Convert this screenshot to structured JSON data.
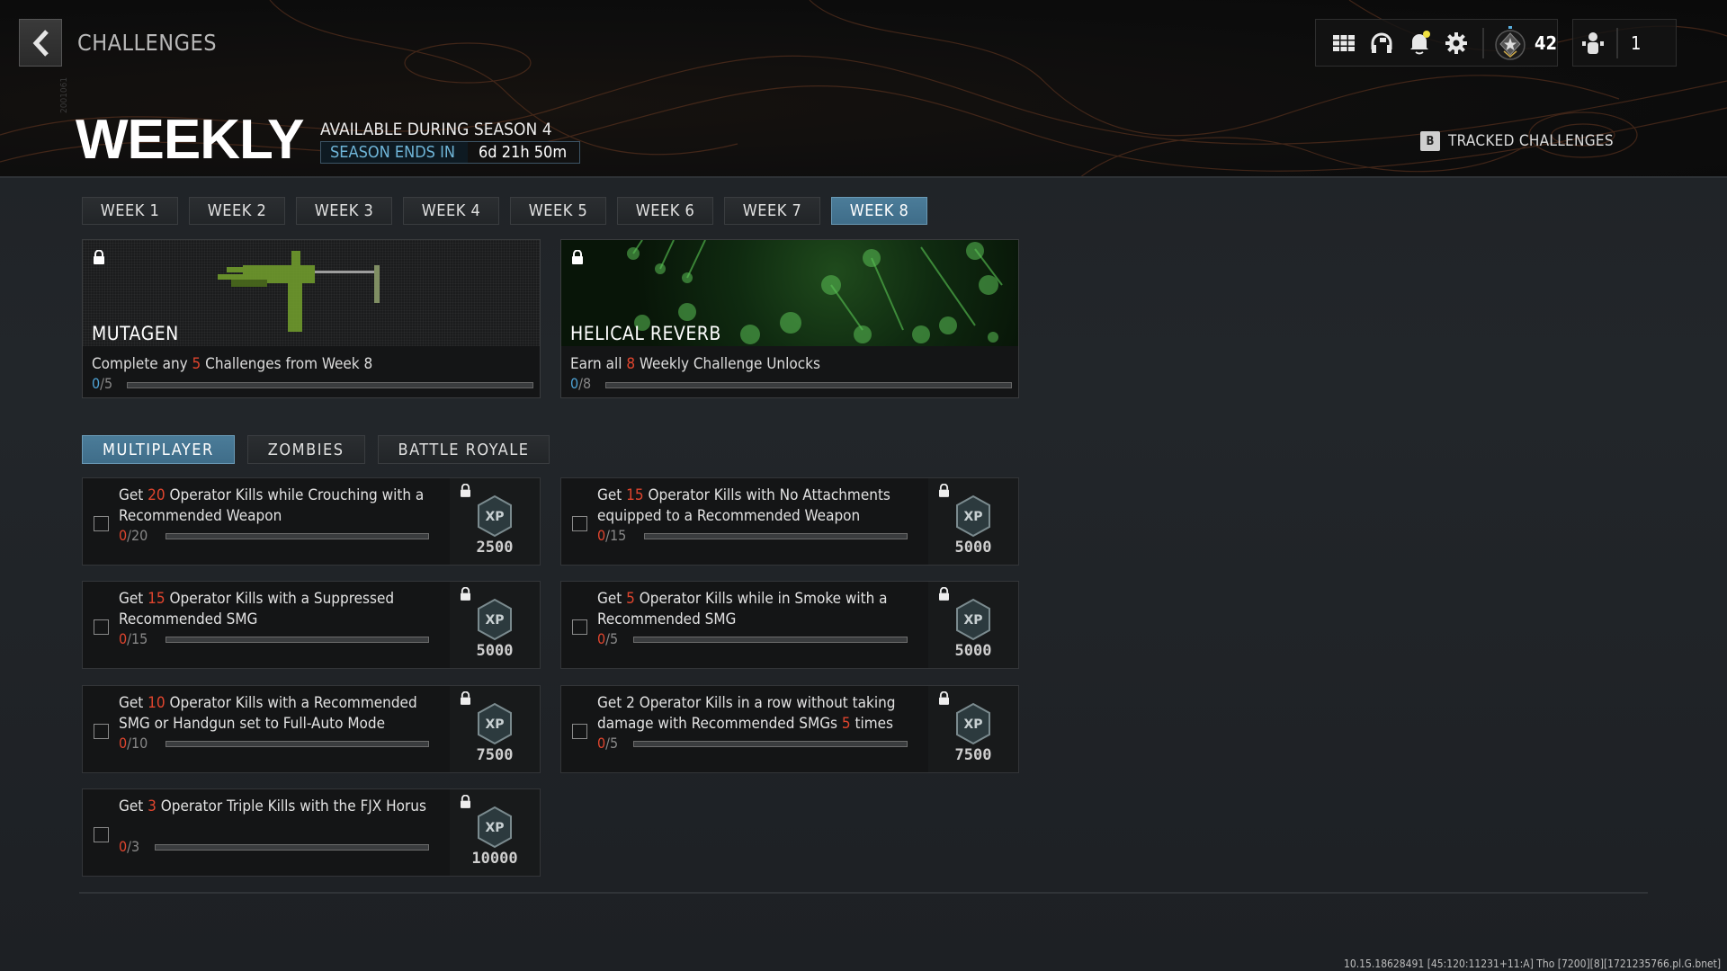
{
  "header": {
    "breadcrumb": "CHALLENGES",
    "vertical_label": "2001061",
    "title": "WEEKLY",
    "availability": "AVAILABLE DURING SEASON 4",
    "season_ends_label": "SEASON ENDS IN",
    "season_ends_value": "6d 21h 50m",
    "hud": {
      "icons": [
        "grid-menu-icon",
        "headset-icon",
        "bell-icon",
        "gear-icon"
      ],
      "notification_dot_color": "#f0e040",
      "rank_value": "42",
      "party_count": "1"
    },
    "tracked": {
      "key": "B",
      "label": "TRACKED CHALLENGES"
    }
  },
  "colors": {
    "accent_blue": "#4b7c99",
    "highlight_red": "#e0452e",
    "progress_blue": "#4ea2d4"
  },
  "week_tabs": [
    {
      "label": "WEEK 1",
      "active": false
    },
    {
      "label": "WEEK 2",
      "active": false
    },
    {
      "label": "WEEK 3",
      "active": false
    },
    {
      "label": "WEEK 4",
      "active": false
    },
    {
      "label": "WEEK 5",
      "active": false
    },
    {
      "label": "WEEK 6",
      "active": false
    },
    {
      "label": "WEEK 7",
      "active": false
    },
    {
      "label": "WEEK 8",
      "active": true
    }
  ],
  "rewards": [
    {
      "name": "MUTAGEN",
      "desc_pre": "Complete any ",
      "desc_hl": "5",
      "desc_post": " Challenges from Week 8",
      "progress_current": "0",
      "progress_total": "/5",
      "progress_fraction": 0,
      "locked": true
    },
    {
      "name": "HELICAL REVERB",
      "desc_pre": "Earn all ",
      "desc_hl": "8",
      "desc_post": " Weekly Challenge Unlocks",
      "progress_current": "0",
      "progress_total": "/8",
      "progress_fraction": 0,
      "locked": true
    }
  ],
  "mode_tabs": [
    {
      "label": "MULTIPLAYER",
      "active": true
    },
    {
      "label": "ZOMBIES",
      "active": false
    },
    {
      "label": "BATTLE ROYALE",
      "active": false
    }
  ],
  "challenges": [
    {
      "pre": "Get ",
      "hl": "20",
      "post": " Operator Kills while Crouching with a Recommended Weapon",
      "cur": "0",
      "total": "/20",
      "fraction": 0,
      "xp": "2500"
    },
    {
      "pre": "Get ",
      "hl": "15",
      "post": " Operator Kills with No Attachments equipped to a Recommended Weapon",
      "cur": "0",
      "total": "/15",
      "fraction": 0,
      "xp": "5000"
    },
    {
      "pre": "Get ",
      "hl": "15",
      "post": " Operator Kills with a Suppressed Recommended SMG",
      "cur": "0",
      "total": "/15",
      "fraction": 0,
      "xp": "5000"
    },
    {
      "pre": "Get ",
      "hl": "5",
      "post": " Operator Kills while in Smoke with a Recommended SMG",
      "cur": "0",
      "total": "/5",
      "fraction": 0,
      "xp": "5000"
    },
    {
      "pre": "Get ",
      "hl": "10",
      "post": " Operator Kills with a Recommended SMG or Handgun set to Full-Auto Mode",
      "cur": "0",
      "total": "/10",
      "fraction": 0,
      "xp": "7500"
    },
    {
      "pre": "Get 2 Operator Kills in a row without taking damage with Recommended SMGs ",
      "hl": "5",
      "post": " times",
      "cur": "0",
      "total": "/5",
      "fraction": 0,
      "xp": "7500"
    },
    {
      "pre": "Get ",
      "hl": "3",
      "post": " Operator Triple Kills with the FJX Horus",
      "cur": "0",
      "total": "/3",
      "fraction": 0,
      "xp": "10000"
    }
  ],
  "footer": {
    "build_info": "10.15.18628491 [45:120:11231+11:A] Tho [7200][8][1721235766.pl.G.bnet]"
  }
}
